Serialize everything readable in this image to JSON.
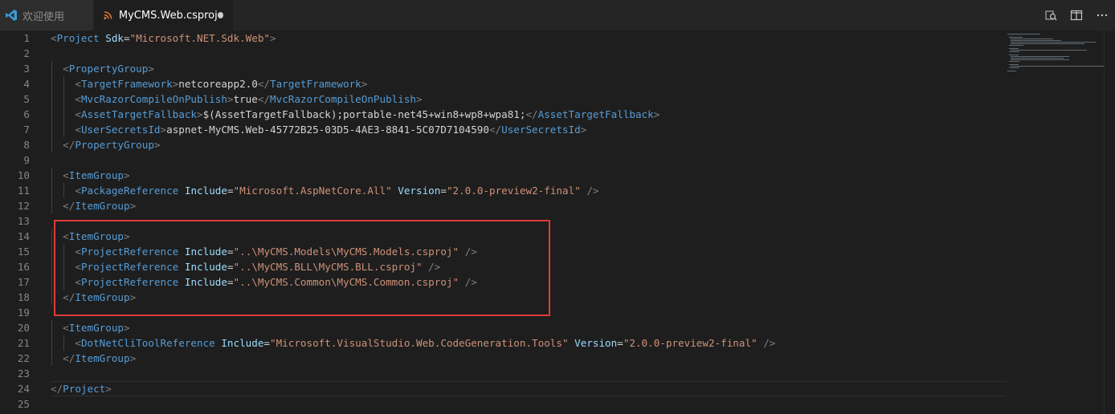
{
  "tabs": [
    {
      "label": "欢迎使用",
      "icon": "vscode-icon",
      "active": false
    },
    {
      "label": "MyCMS.Web.csproj",
      "icon": "rss-file-icon",
      "active": true,
      "modified": true
    }
  ],
  "actions": [
    "open-changes-icon",
    "split-editor-icon",
    "more-actions-icon"
  ],
  "line_numbers": [
    "1",
    "2",
    "3",
    "4",
    "5",
    "6",
    "7",
    "8",
    "9",
    "10",
    "11",
    "12",
    "13",
    "14",
    "15",
    "16",
    "17",
    "18",
    "19",
    "20",
    "21",
    "22",
    "23",
    "24",
    "25"
  ],
  "colors": {
    "tag": "#569cd6",
    "attr": "#9cdcfe",
    "string": "#ce9178",
    "text": "#d4d4d4",
    "punct": "#808080",
    "highlight_box": "#e03a3a"
  },
  "code_lines": [
    {
      "indent": 0,
      "tokens": [
        [
          "punct",
          "<"
        ],
        [
          "tag",
          "Project"
        ],
        [
          "text",
          " "
        ],
        [
          "attr",
          "Sdk"
        ],
        [
          "text",
          "="
        ],
        [
          "str",
          "\"Microsoft.NET.Sdk.Web\""
        ],
        [
          "punct",
          ">"
        ]
      ]
    },
    {
      "indent": 0,
      "tokens": []
    },
    {
      "indent": 1,
      "tokens": [
        [
          "punct",
          "<"
        ],
        [
          "tag",
          "PropertyGroup"
        ],
        [
          "punct",
          ">"
        ]
      ]
    },
    {
      "indent": 2,
      "tokens": [
        [
          "punct",
          "<"
        ],
        [
          "tag",
          "TargetFramework"
        ],
        [
          "punct",
          ">"
        ],
        [
          "text",
          "netcoreapp2.0"
        ],
        [
          "punct",
          "</"
        ],
        [
          "tag",
          "TargetFramework"
        ],
        [
          "punct",
          ">"
        ]
      ]
    },
    {
      "indent": 2,
      "tokens": [
        [
          "punct",
          "<"
        ],
        [
          "tag",
          "MvcRazorCompileOnPublish"
        ],
        [
          "punct",
          ">"
        ],
        [
          "text",
          "true"
        ],
        [
          "punct",
          "</"
        ],
        [
          "tag",
          "MvcRazorCompileOnPublish"
        ],
        [
          "punct",
          ">"
        ]
      ]
    },
    {
      "indent": 2,
      "tokens": [
        [
          "punct",
          "<"
        ],
        [
          "tag",
          "AssetTargetFallback"
        ],
        [
          "punct",
          ">"
        ],
        [
          "text",
          "$(AssetTargetFallback);portable-net45+win8+wp8+wpa81;"
        ],
        [
          "punct",
          "</"
        ],
        [
          "tag",
          "AssetTargetFallback"
        ],
        [
          "punct",
          ">"
        ]
      ]
    },
    {
      "indent": 2,
      "tokens": [
        [
          "punct",
          "<"
        ],
        [
          "tag",
          "UserSecretsId"
        ],
        [
          "punct",
          ">"
        ],
        [
          "text",
          "aspnet-MyCMS.Web-45772B25-03D5-4AE3-8841-5C07D7104590"
        ],
        [
          "punct",
          "</"
        ],
        [
          "tag",
          "UserSecretsId"
        ],
        [
          "punct",
          ">"
        ]
      ]
    },
    {
      "indent": 1,
      "tokens": [
        [
          "punct",
          "</"
        ],
        [
          "tag",
          "PropertyGroup"
        ],
        [
          "punct",
          ">"
        ]
      ]
    },
    {
      "indent": 0,
      "tokens": []
    },
    {
      "indent": 1,
      "tokens": [
        [
          "punct",
          "<"
        ],
        [
          "tag",
          "ItemGroup"
        ],
        [
          "punct",
          ">"
        ]
      ]
    },
    {
      "indent": 2,
      "tokens": [
        [
          "punct",
          "<"
        ],
        [
          "tag",
          "PackageReference"
        ],
        [
          "text",
          " "
        ],
        [
          "attr",
          "Include"
        ],
        [
          "text",
          "="
        ],
        [
          "str",
          "\"Microsoft.AspNetCore.All\""
        ],
        [
          "text",
          " "
        ],
        [
          "attr",
          "Version"
        ],
        [
          "text",
          "="
        ],
        [
          "str",
          "\"2.0.0-preview2-final\""
        ],
        [
          "text",
          " "
        ],
        [
          "punct",
          "/>"
        ]
      ]
    },
    {
      "indent": 1,
      "tokens": [
        [
          "punct",
          "</"
        ],
        [
          "tag",
          "ItemGroup"
        ],
        [
          "punct",
          ">"
        ]
      ]
    },
    {
      "indent": 0,
      "tokens": []
    },
    {
      "indent": 1,
      "tokens": [
        [
          "punct",
          "<"
        ],
        [
          "tag",
          "ItemGroup"
        ],
        [
          "punct",
          ">"
        ]
      ]
    },
    {
      "indent": 2,
      "tokens": [
        [
          "punct",
          "<"
        ],
        [
          "tag",
          "ProjectReference"
        ],
        [
          "text",
          " "
        ],
        [
          "attr",
          "Include"
        ],
        [
          "text",
          "="
        ],
        [
          "str",
          "\"..\\MyCMS.Models\\MyCMS.Models.csproj\""
        ],
        [
          "text",
          " "
        ],
        [
          "punct",
          "/>"
        ]
      ]
    },
    {
      "indent": 2,
      "tokens": [
        [
          "punct",
          "<"
        ],
        [
          "tag",
          "ProjectReference"
        ],
        [
          "text",
          " "
        ],
        [
          "attr",
          "Include"
        ],
        [
          "text",
          "="
        ],
        [
          "str",
          "\"..\\MyCMS.BLL\\MyCMS.BLL.csproj\""
        ],
        [
          "text",
          " "
        ],
        [
          "punct",
          "/>"
        ]
      ]
    },
    {
      "indent": 2,
      "tokens": [
        [
          "punct",
          "<"
        ],
        [
          "tag",
          "ProjectReference"
        ],
        [
          "text",
          " "
        ],
        [
          "attr",
          "Include"
        ],
        [
          "text",
          "="
        ],
        [
          "str",
          "\"..\\MyCMS.Common\\MyCMS.Common.csproj\""
        ],
        [
          "text",
          " "
        ],
        [
          "punct",
          "/>"
        ]
      ]
    },
    {
      "indent": 1,
      "tokens": [
        [
          "punct",
          "</"
        ],
        [
          "tag",
          "ItemGroup"
        ],
        [
          "punct",
          ">"
        ]
      ]
    },
    {
      "indent": 0,
      "tokens": []
    },
    {
      "indent": 1,
      "tokens": [
        [
          "punct",
          "<"
        ],
        [
          "tag",
          "ItemGroup"
        ],
        [
          "punct",
          ">"
        ]
      ]
    },
    {
      "indent": 2,
      "tokens": [
        [
          "punct",
          "<"
        ],
        [
          "tag",
          "DotNetCliToolReference"
        ],
        [
          "text",
          " "
        ],
        [
          "attr",
          "Include"
        ],
        [
          "text",
          "="
        ],
        [
          "str",
          "\"Microsoft.VisualStudio.Web.CodeGeneration.Tools\""
        ],
        [
          "text",
          " "
        ],
        [
          "attr",
          "Version"
        ],
        [
          "text",
          "="
        ],
        [
          "str",
          "\"2.0.0-preview2-final\""
        ],
        [
          "text",
          " "
        ],
        [
          "punct",
          "/>"
        ]
      ]
    },
    {
      "indent": 1,
      "tokens": [
        [
          "punct",
          "</"
        ],
        [
          "tag",
          "ItemGroup"
        ],
        [
          "punct",
          ">"
        ]
      ]
    },
    {
      "indent": 0,
      "tokens": []
    },
    {
      "indent": 0,
      "tokens": [
        [
          "punct",
          "</"
        ],
        [
          "tag",
          "Project"
        ],
        [
          "punct",
          ">"
        ]
      ]
    },
    {
      "indent": 0,
      "tokens": []
    }
  ]
}
